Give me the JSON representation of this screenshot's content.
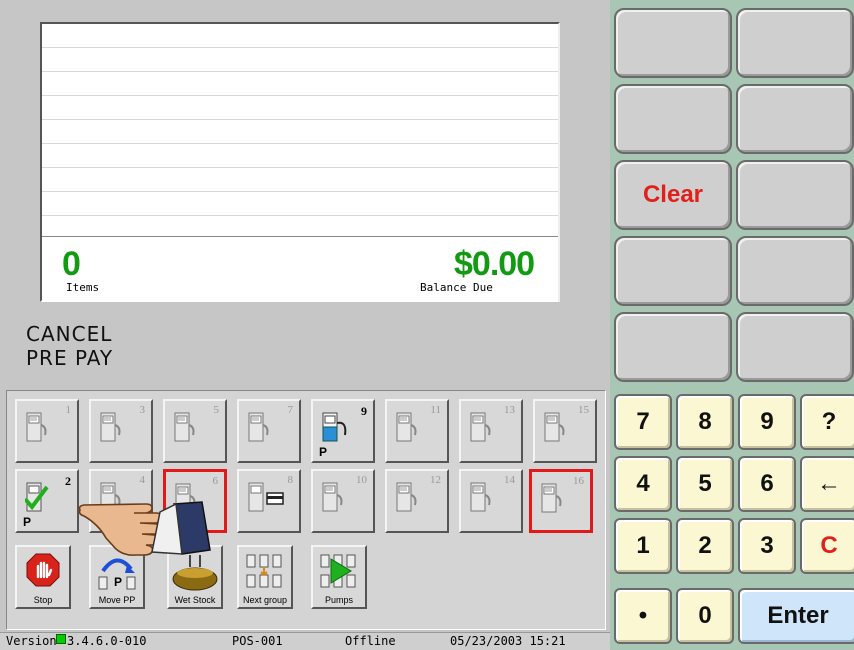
{
  "receipt": {
    "items_count": "0",
    "items_label": "Items",
    "balance_amount": "$0.00",
    "balance_label": "Balance Due"
  },
  "message": {
    "line1": "CANCEL",
    "line2": "PRE PAY"
  },
  "pumps": [
    {
      "number": "1"
    },
    {
      "number": "3"
    },
    {
      "number": "5"
    },
    {
      "number": "7"
    },
    {
      "number": "9",
      "flag": "P"
    },
    {
      "number": "11"
    },
    {
      "number": "13"
    },
    {
      "number": "15"
    },
    {
      "number": "2",
      "flag": "P"
    },
    {
      "number": "4"
    },
    {
      "number": "6"
    },
    {
      "number": "8"
    },
    {
      "number": "10"
    },
    {
      "number": "12"
    },
    {
      "number": "14"
    },
    {
      "number": "16"
    }
  ],
  "function_buttons": {
    "stop": "Stop",
    "move_pp": "Move PP",
    "move_pp_flag": "P",
    "wet_stock": "Wet Stock",
    "next_group": "Next group",
    "pumps": "Pumps"
  },
  "status_bar": {
    "version_label": "Version",
    "version_number": "3.4.6.0-010",
    "pos": "POS-001",
    "state": "Offline",
    "datetime": "05/23/2003 15:21"
  },
  "function_keys": {
    "clear": "Clear"
  },
  "keypad": {
    "k7": "7",
    "k8": "8",
    "k9": "9",
    "help": "?",
    "k4": "4",
    "k5": "5",
    "k6": "6",
    "back": "←",
    "k1": "1",
    "k2": "2",
    "k3": "3",
    "cancel": "C",
    "dot": "•",
    "k0": "0",
    "enter": "Enter"
  },
  "colors": {
    "amount_green": "#129a12",
    "alert_red": "#e01a1a",
    "keypad_bg": "#a7c7b4",
    "keypad_key": "#fbf7d2",
    "enter_key": "#cfe6fa"
  }
}
